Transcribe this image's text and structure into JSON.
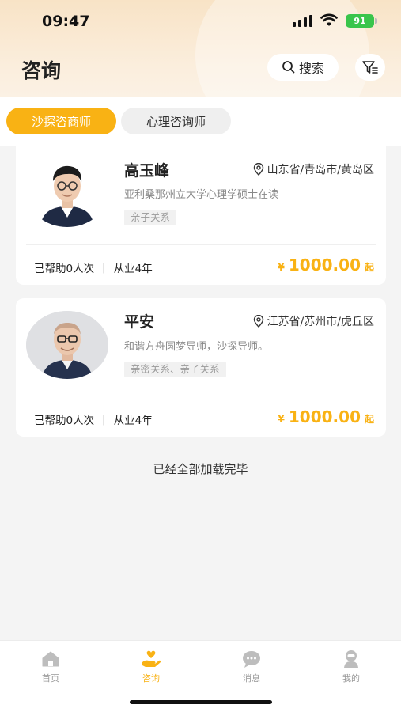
{
  "status_bar": {
    "time": "09:47",
    "battery": "91"
  },
  "header": {
    "title": "咨询",
    "search_label": "搜索"
  },
  "tabs": [
    {
      "label": "沙探咨商师",
      "active": true
    },
    {
      "label": "心理咨询师",
      "active": false
    }
  ],
  "consultants": [
    {
      "name": "高玉峰",
      "location": "山东省/青岛市/黄岛区",
      "intro": "亚利桑那州立大学心理学硕士在读",
      "tag": "亲子关系",
      "helped": "已帮助0人次",
      "experience": "从业4年",
      "currency": "¥",
      "price": "1000.00",
      "price_suffix": "起"
    },
    {
      "name": "平安",
      "location": "江苏省/苏州市/虎丘区",
      "intro": "和谐方舟圆梦导师，沙探导师。",
      "tag": "亲密关系、亲子关系",
      "helped": "已帮助0人次",
      "experience": "从业4年",
      "currency": "¥",
      "price": "1000.00",
      "price_suffix": "起"
    }
  ],
  "list_end_text": "已经全部加载完毕",
  "bottom_nav": [
    {
      "label": "首页",
      "icon": "home-icon",
      "active": false
    },
    {
      "label": "咨询",
      "icon": "heart-hand-icon",
      "active": true
    },
    {
      "label": "消息",
      "icon": "chat-icon",
      "active": false
    },
    {
      "label": "我的",
      "icon": "user-icon",
      "active": false
    }
  ],
  "colors": {
    "accent": "#f9b214",
    "header_bg": "#f8e3c6",
    "page_bg": "#f4f4f4",
    "battery_green": "#39c54b"
  }
}
